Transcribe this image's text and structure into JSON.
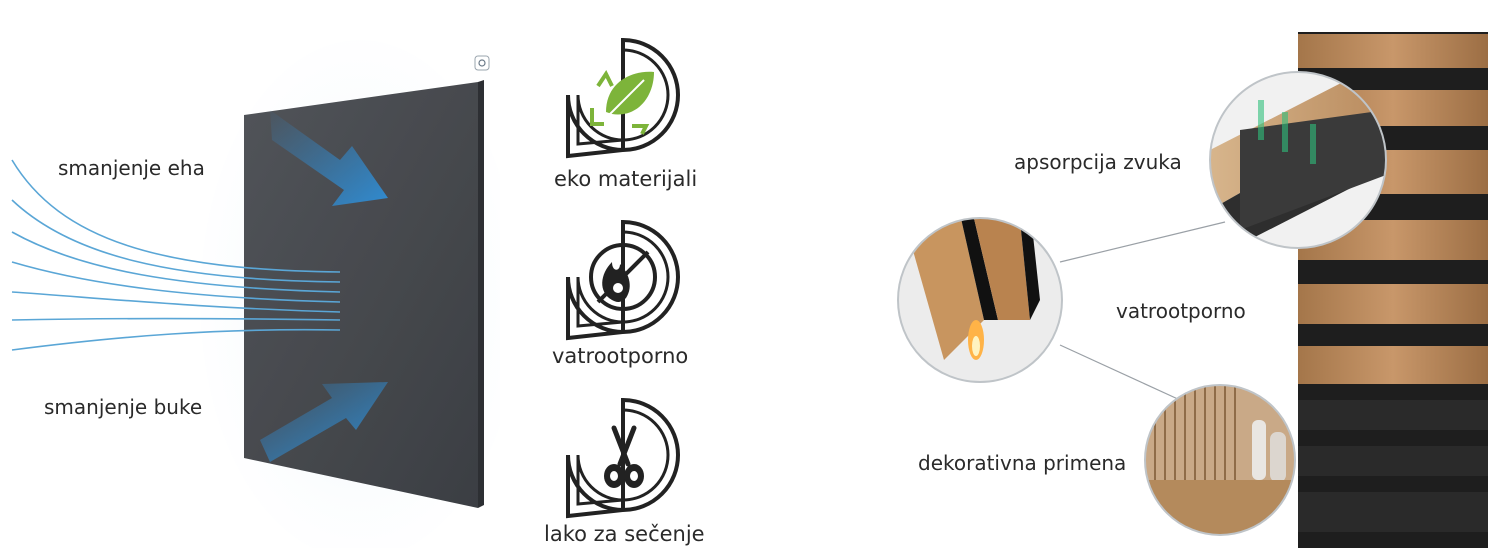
{
  "left_panel": {
    "label_echo": "smanjenje eha",
    "label_noise": "smanjenje buke"
  },
  "feature_icons": [
    {
      "icon": "leaf-recycle-icon",
      "label": "eko materijali"
    },
    {
      "icon": "no-fire-icon",
      "label": "vatrootporno"
    },
    {
      "icon": "scissors-icon",
      "label": "lako za sečenje"
    }
  ],
  "right_panel": {
    "label_absorb": "apsorpcija zvuka",
    "label_fire": "vatrootporno",
    "label_decor": "dekorativna primena"
  },
  "colors": {
    "felt": "#4a4d52",
    "arrow": "#2f8fd8",
    "wave": "#5aa6d6",
    "wood": "#b9875a",
    "slat_dark": "#1c1c1c",
    "leaf_green": "#7db43a"
  }
}
